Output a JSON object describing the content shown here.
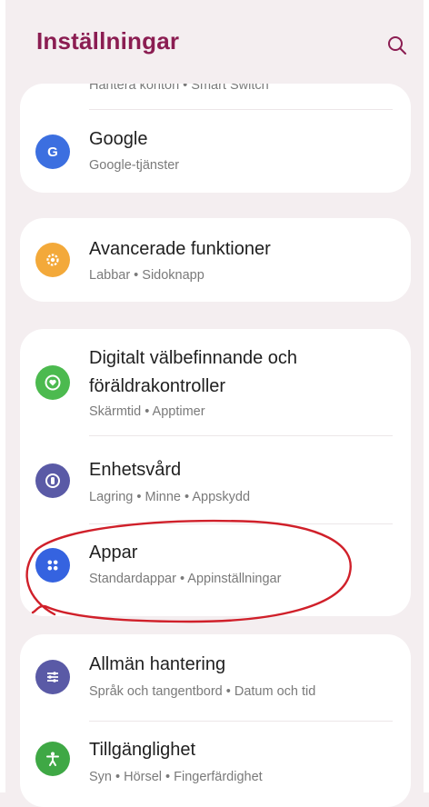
{
  "header": {
    "title": "Inställningar",
    "search_icon": "search-icon"
  },
  "partial_row": {
    "subtitle": "Hantera konton • Smart Switch"
  },
  "colors": {
    "title": "#8b1d52",
    "background": "#f4eef0",
    "card": "#ffffff",
    "annotation_circle": "#d0202a"
  },
  "items": [
    {
      "id": "google",
      "title": "Google",
      "subtitle": "Google-tjänster",
      "icon": "google-g-icon",
      "color": "#3c6fe0"
    },
    {
      "id": "advanced",
      "title": "Avancerade funktioner",
      "subtitle": "Labbar • Sidoknapp",
      "icon": "gear-star-icon",
      "color": "#f3a93a"
    },
    {
      "id": "wellbeing",
      "title": "Digitalt välbefinnande och föräldrakontroller",
      "subtitle": "Skärmtid • Apptimer",
      "icon": "wellbeing-heart-icon",
      "color": "#4cba4f"
    },
    {
      "id": "device-care",
      "title": "Enhetsvård",
      "subtitle": "Lagring • Minne • Appskydd",
      "icon": "device-care-icon",
      "color": "#5a5aa6"
    },
    {
      "id": "apps",
      "title": "Appar",
      "subtitle": "Standardappar • Appinställningar",
      "icon": "apps-grid-icon",
      "color": "#3563e0"
    },
    {
      "id": "general",
      "title": "Allmän hantering",
      "subtitle": "Språk och tangentbord • Datum och tid",
      "icon": "sliders-icon",
      "color": "#5a5aa6"
    },
    {
      "id": "accessibility",
      "title": "Tillgänglighet",
      "subtitle": "Syn • Hörsel • Fingerfärdighet",
      "icon": "accessibility-person-icon",
      "color": "#3fa845"
    }
  ]
}
